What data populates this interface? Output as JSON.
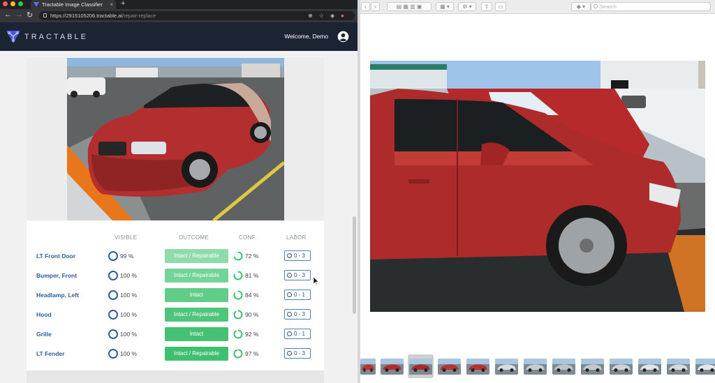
{
  "browser": {
    "tab_title": "Tractable Image Classifier",
    "tab_close": "×",
    "new_tab": "+",
    "url_host": "https://2915105206.tractable.ai",
    "url_path": "/repair-replace"
  },
  "app": {
    "brand": "TRACTABLE",
    "welcome": "Welcome, Demo"
  },
  "table": {
    "headers": {
      "visible": "VISIBLE",
      "outcome": "OUTCOME",
      "conf": "CONF.",
      "labor": "LABOR"
    },
    "rows": [
      {
        "part": "LT Front Door",
        "visible": "99 %",
        "outcome": "Intact / Repairable",
        "conf": "72 %",
        "conf_value": 0.72,
        "labor": "0 - 3",
        "outcome_color": "#8fdcaa"
      },
      {
        "part": "Bumper, Front",
        "visible": "100 %",
        "outcome": "Intact / Repairable",
        "conf": "81 %",
        "conf_value": 0.81,
        "labor": "0 - 3",
        "outcome_color": "#74d397"
      },
      {
        "part": "Headlamp, Left",
        "visible": "100 %",
        "outcome": "Intact",
        "conf": "84 %",
        "conf_value": 0.84,
        "labor": "0 - 1",
        "outcome_color": "#62cc89"
      },
      {
        "part": "Hood",
        "visible": "100 %",
        "outcome": "Intact / Repairable",
        "conf": "90 %",
        "conf_value": 0.9,
        "labor": "0 - 3",
        "outcome_color": "#4ec57a"
      },
      {
        "part": "Grille",
        "visible": "100 %",
        "outcome": "Intact",
        "conf": "92 %",
        "conf_value": 0.92,
        "labor": "0 - 1",
        "outcome_color": "#45c173"
      },
      {
        "part": "LT Fender",
        "visible": "100 %",
        "outcome": "Intact / Repairable",
        "conf": "97 %",
        "conf_value": 0.97,
        "labor": "0 - 3",
        "outcome_color": "#3fbf70"
      }
    ]
  },
  "viewer": {
    "search_placeholder": "Search"
  },
  "colors": {
    "header_bg": "#1c2434",
    "link_blue": "#2a5d9e",
    "ring_blue": "#2c5e9e",
    "conf_green": "#3fbf70"
  },
  "icons": [
    "lock-icon",
    "zoom-icon",
    "star-icon",
    "extension-icon",
    "profile-icon",
    "user-icon",
    "clock-icon",
    "spinner-icon",
    "search-icon",
    "cursor-icon"
  ]
}
